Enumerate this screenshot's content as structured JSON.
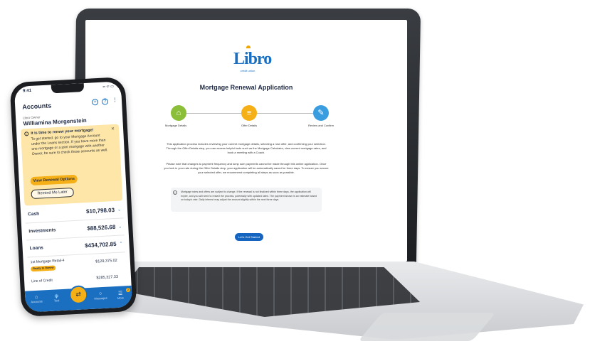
{
  "laptop": {
    "logo_text": "Libro",
    "logo_sub": "credit union",
    "title": "Mortgage Renewal Application",
    "steps": [
      {
        "label": "Mortgage Details",
        "icon": "house-icon"
      },
      {
        "label": "Offer Details",
        "icon": "document-icon"
      },
      {
        "label": "Review and Confirm",
        "icon": "pencil-icon"
      }
    ],
    "para1": "This application process includes reviewing your current mortgage details, selecting a new offer, and confirming your selection. Through the Offer Details step, you can access helpful tools such as the Mortgage Calculator, view current mortgage rates, and book a meeting with a Coach.",
    "para2": "Please note that changes to payment frequency and lump sum payments cannot be made through this online application. Once you lock in your rate during the Offer Details step, your application will be automatically saved for three days. To ensure you secure your selected offer, we recommend completing all steps as soon as possible.",
    "note": "Mortgage rates and offers are subject to change. If the renewal is not finalized within three days, the application will expire, and you will need to restart the process, potentially with updated rates. The payment shown is an estimate based on today's rate. Daily interest may adjust the amount slightly within the next three days.",
    "start_button": "Let's Get Started"
  },
  "phone": {
    "time": "9:41",
    "status_icons": "▪▪ ᯤ ▭",
    "title": "Accounts",
    "owner_label": "Libro Owner",
    "owner_name": "Williamina Morgenstein",
    "alert": {
      "title": "It is time to renew your mortgage!",
      "body": "To get started, go to your Mortgage Account under the Loans section. If you have more than one mortgage or a joint mortgage with another Owner, be sure to check those accounts as well.",
      "primary_button": "View Renewal Options",
      "secondary_button": "Remind Me Later"
    },
    "rows": [
      {
        "label": "Cash",
        "value": "$10,798.03"
      },
      {
        "label": "Investments",
        "value": "$88,526.68"
      },
      {
        "label": "Loans",
        "value": "$434,702.85"
      }
    ],
    "loans": [
      {
        "label": "1st Mortgage Retail-4",
        "value": "$129,375.02",
        "badge": "Ready to Renew"
      },
      {
        "label": "Line of Credit",
        "value": "$285,327.33"
      }
    ],
    "tabs": [
      "Accounts",
      "Tool",
      "",
      "Messages",
      "More"
    ],
    "more_badge": "2"
  }
}
